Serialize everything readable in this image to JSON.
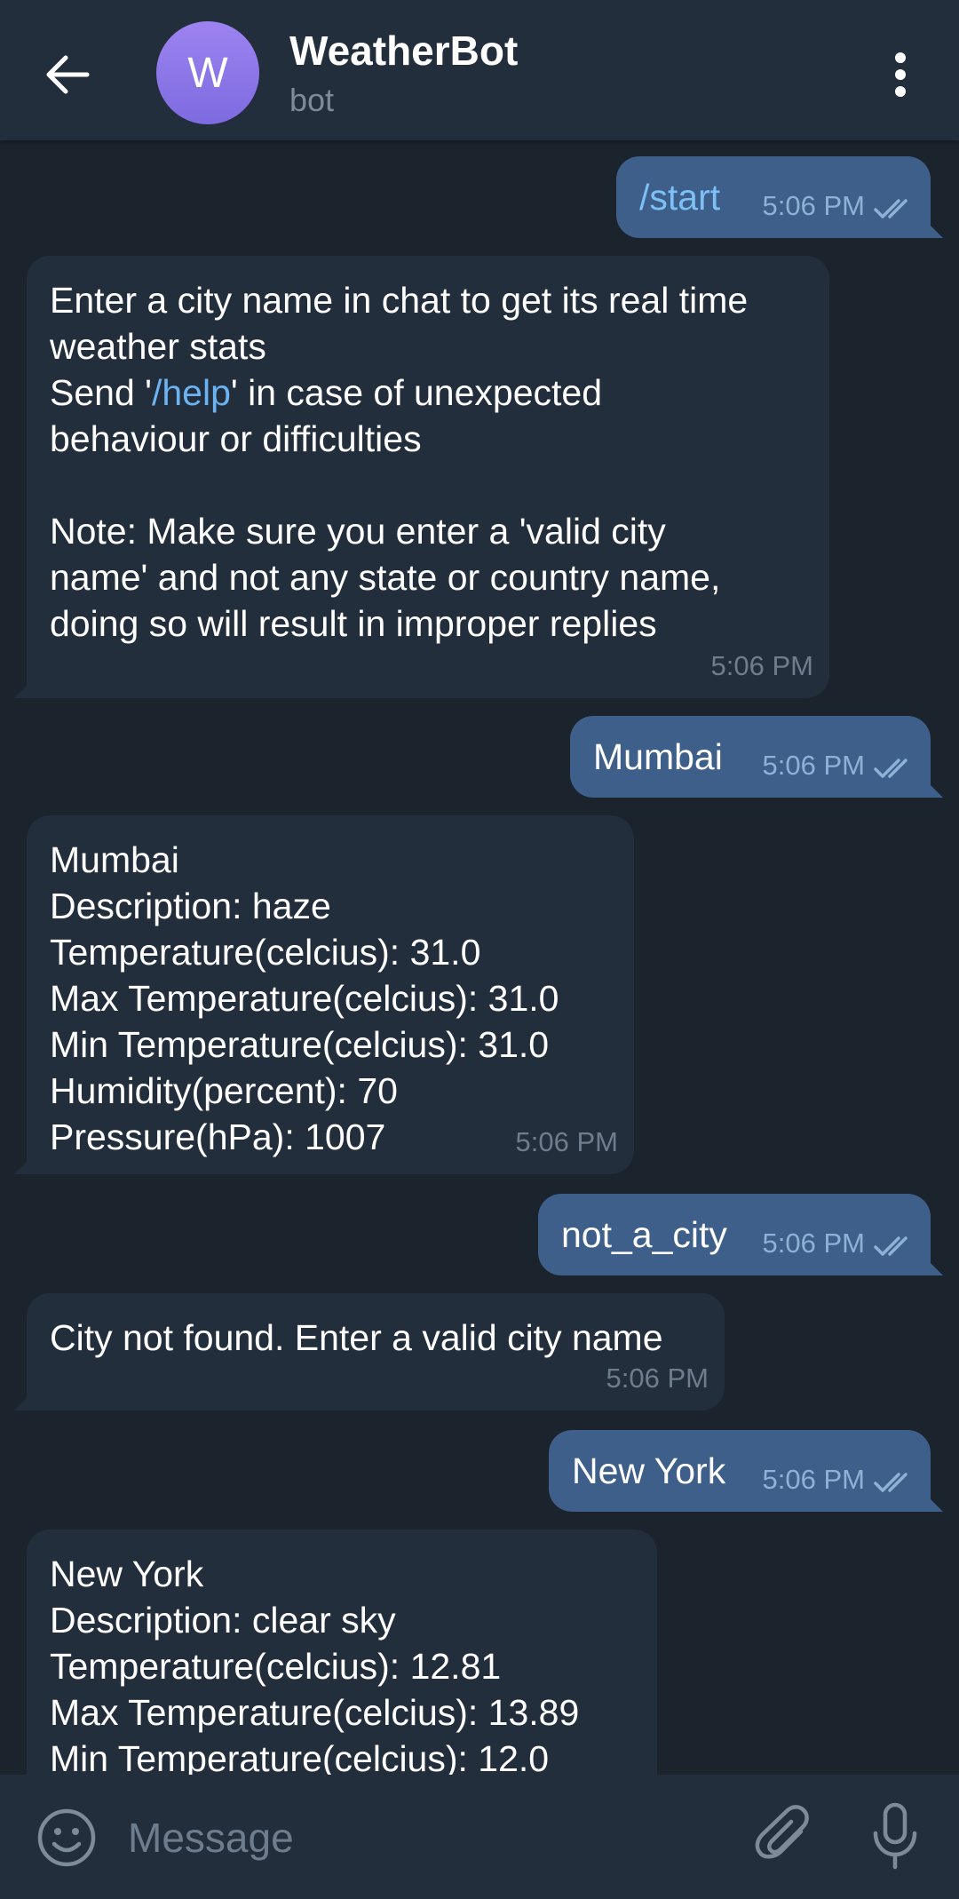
{
  "header": {
    "avatar_letter": "W",
    "title": "WeatherBot",
    "subtitle": "bot"
  },
  "messages": [
    {
      "dir": "out",
      "text": "/start",
      "time": "5:06 PM",
      "status": "read"
    },
    {
      "dir": "in",
      "text_part1": "Enter a city name in chat to get its real time\nweather stats\nSend '",
      "link": "/help",
      "text_part2": "' in case of unexpected\nbehaviour or difficulties\n\nNote: Make sure you enter a 'valid city\nname' and not any state or country name,\ndoing so will result in improper replies",
      "time": "5:06 PM"
    },
    {
      "dir": "out",
      "text": "Mumbai",
      "time": "5:06 PM",
      "status": "read"
    },
    {
      "dir": "in",
      "text": "Mumbai\nDescription: haze\nTemperature(celcius): 31.0\nMax Temperature(celcius): 31.0\nMin Temperature(celcius): 31.0\nHumidity(percent): 70\nPressure(hPa): 1007",
      "time": "5:06 PM"
    },
    {
      "dir": "out",
      "text": "not_a_city",
      "time": "5:06 PM",
      "status": "read"
    },
    {
      "dir": "in",
      "text": "City not found. Enter a valid city name",
      "time": "5:06 PM"
    },
    {
      "dir": "out",
      "text": "New York",
      "time": "5:06 PM",
      "status": "read"
    },
    {
      "dir": "in",
      "text": "New York\nDescription: clear sky\nTemperature(celcius): 12.81\nMax Temperature(celcius): 13.89\nMin Temperature(celcius): 12.0"
    }
  ],
  "input": {
    "placeholder": "Message",
    "value": ""
  },
  "icons": {
    "back": "arrow-left-icon",
    "menu": "more-vertical-icon",
    "emoji": "emoji-icon",
    "attach": "paperclip-icon",
    "mic": "microphone-icon",
    "read": "double-check-icon"
  },
  "colors": {
    "background": "#1b232d",
    "header": "#232e3c",
    "incoming_bubble": "#232e3c",
    "outgoing_bubble": "#3e5f8a",
    "avatar": "#8a74e8",
    "link": "#6cb3f2",
    "read_check": "#8eb1d6"
  }
}
